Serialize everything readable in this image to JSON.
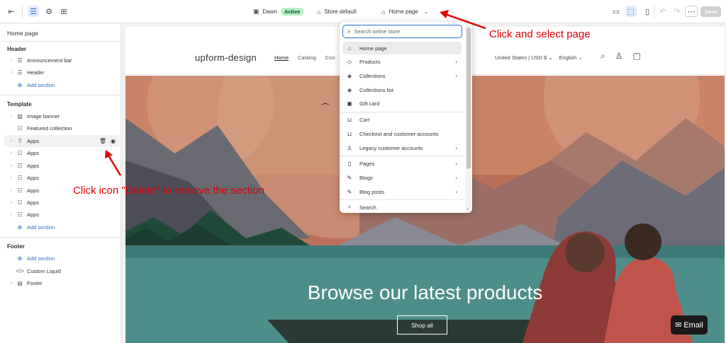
{
  "topbar": {
    "theme_name": "Dawn",
    "theme_status": "Active",
    "store": "Store default",
    "page_selector": "Home page",
    "save_label": "Save"
  },
  "sidebar": {
    "title": "Home page",
    "header_section": {
      "heading": "Header",
      "items": [
        "Announcement bar",
        "Header"
      ],
      "add_label": "Add section"
    },
    "template_section": {
      "heading": "Template",
      "items": [
        "Image banner",
        "Featured collection",
        "Apps",
        "Apps",
        "Apps",
        "Apps",
        "Apps",
        "Apps",
        "Apps"
      ],
      "add_label": "Add section"
    },
    "footer_section": {
      "heading": "Footer",
      "add_label": "Add section",
      "items": [
        "Custom Liquid",
        "Footer"
      ]
    }
  },
  "store": {
    "brand": "upform-design",
    "nav": [
      "Home",
      "Catalog",
      "Con"
    ],
    "locale": "United States | USD $",
    "language": "English",
    "banner_title": "Browse our latest products",
    "shop_button": "Shop all",
    "email_button": "Email"
  },
  "dropdown": {
    "search_placeholder": "Search online store",
    "items": [
      {
        "label": "Home page",
        "icon": "home-icon",
        "arrow": false
      },
      {
        "label": "Products",
        "icon": "tag-icon",
        "arrow": true
      },
      {
        "label": "Collections",
        "icon": "collection-icon",
        "arrow": true
      },
      {
        "label": "Collections list",
        "icon": "collections-list-icon",
        "arrow": false
      },
      {
        "label": "Gift card",
        "icon": "gift-card-icon",
        "arrow": false
      },
      {
        "label": "Cart",
        "icon": "cart-icon",
        "arrow": false
      },
      {
        "label": "Checkout and customer accounts",
        "icon": "checkout-icon",
        "arrow": false
      },
      {
        "label": "Legacy customer accounts",
        "icon": "person-icon",
        "arrow": true
      },
      {
        "label": "Pages",
        "icon": "page-icon",
        "arrow": true
      },
      {
        "label": "Blogs",
        "icon": "blog-icon",
        "arrow": true
      },
      {
        "label": "Blog posts",
        "icon": "blog-post-icon",
        "arrow": true
      },
      {
        "label": "Search",
        "icon": "search-icon",
        "arrow": false
      }
    ]
  },
  "annotations": {
    "select_page": "Click and select page",
    "delete_icon": "Click icon \"Delete\" to remove the section"
  },
  "colors": {
    "accent": "#2c6ecb",
    "annotation": "#e00000",
    "active_badge": "#b4f0c4"
  }
}
